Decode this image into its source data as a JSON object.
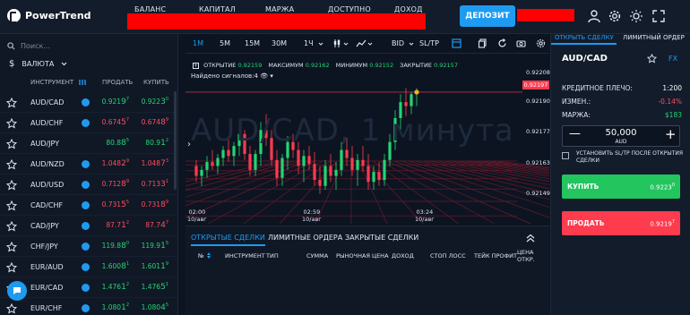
{
  "app": {
    "name": "PowerTrend"
  },
  "topbar": {
    "stats": [
      "БАЛАНС",
      "КАПИТАЛ",
      "МАРЖА",
      "ДОСТУПНО",
      "ДОХОД"
    ],
    "deposit_label": "ДЕПОЗИТ",
    "icons": [
      "user-icon",
      "gear-icon",
      "sun-icon",
      "fullscreen-icon"
    ]
  },
  "left": {
    "search_placeholder": "Поиск...",
    "currency_label": "ВАЛЮТА",
    "columns": {
      "instrument": "ИНСТРУМЕНТ",
      "sell": "ПРОДАТЬ",
      "buy": "КУПИТЬ"
    },
    "rows": [
      {
        "symbol": "AUD/CAD",
        "badge": true,
        "sell": [
          "0.921",
          "9",
          "7"
        ],
        "sell_dir": "green",
        "buy": [
          "0.922",
          "3",
          "0"
        ],
        "buy_dir": "green"
      },
      {
        "symbol": "AUD/CHF",
        "badge": true,
        "sell": [
          "0.674",
          "5",
          "7"
        ],
        "sell_dir": "red",
        "buy": [
          "0.674",
          "8",
          "9"
        ],
        "buy_dir": "red"
      },
      {
        "symbol": "AUD/JPY",
        "badge": false,
        "sell": [
          "80.8",
          "8",
          "5"
        ],
        "sell_dir": "green",
        "buy": [
          "80.9",
          "1",
          "2"
        ],
        "buy_dir": "green"
      },
      {
        "symbol": "AUD/NZD",
        "badge": true,
        "sell": [
          "1.048",
          "2",
          "9"
        ],
        "sell_dir": "red",
        "buy": [
          "1.048",
          "7",
          "3"
        ],
        "buy_dir": "red"
      },
      {
        "symbol": "AUD/USD",
        "badge": true,
        "sell": [
          "0.712",
          "8",
          "9"
        ],
        "sell_dir": "red",
        "buy": [
          "0.713",
          "3",
          "1"
        ],
        "buy_dir": "red"
      },
      {
        "symbol": "CAD/CHF",
        "badge": true,
        "sell": [
          "0.731",
          "5",
          "5"
        ],
        "sell_dir": "red",
        "buy": [
          "0.731",
          "8",
          "9"
        ],
        "buy_dir": "red"
      },
      {
        "symbol": "CAD/JPY",
        "badge": true,
        "sell": [
          "87.7",
          "1",
          "2"
        ],
        "sell_dir": "red",
        "buy": [
          "87.7",
          "4",
          "7"
        ],
        "buy_dir": "red"
      },
      {
        "symbol": "CHF/JPY",
        "badge": true,
        "sell": [
          "119.8",
          "8",
          "0"
        ],
        "sell_dir": "green",
        "buy": [
          "119.9",
          "1",
          "5"
        ],
        "buy_dir": "green"
      },
      {
        "symbol": "EUR/AUD",
        "badge": true,
        "sell": [
          "1.600",
          "8",
          "1"
        ],
        "sell_dir": "green",
        "buy": [
          "1.601",
          "1",
          "9"
        ],
        "buy_dir": "green"
      },
      {
        "symbol": "EUR/CAD",
        "badge": true,
        "sell": [
          "1.476",
          "1",
          "2"
        ],
        "sell_dir": "green",
        "buy": [
          "1.476",
          "5",
          "1"
        ],
        "buy_dir": "green"
      },
      {
        "symbol": "EUR/CHF",
        "badge": true,
        "sell": [
          "1.080",
          "1",
          "2"
        ],
        "sell_dir": "green",
        "buy": [
          "1.080",
          "4",
          "5"
        ],
        "buy_dir": "green"
      }
    ]
  },
  "toolbar": {
    "timeframes": [
      "1M",
      "5M",
      "15M",
      "30M",
      "1Ч"
    ],
    "active_timeframe": "1M",
    "bid_label": "BID",
    "sltp_label": "SL/TP"
  },
  "chart": {
    "ohlc": {
      "open_label": "ОТКРЫТИЕ",
      "open": "0.92159",
      "high_label": "МАКСИМУМ",
      "high": "0.92162",
      "low_label": "МИНИМУМ",
      "low": "0.92152",
      "close_label": "ЗАКРЫТИЕ",
      "close": "0.92157"
    },
    "signals": "Найдено сигналов:4",
    "watermark": "AUD/CAD, 1 минута",
    "current_price": "0.92197",
    "price_ticks": [
      "0.92208",
      "0.92190",
      "0.92177",
      "0.92163",
      "0.92149"
    ],
    "time_ticks": [
      {
        "time": "02:00",
        "date": "10/авг"
      },
      {
        "time": "02:59",
        "date": "10/авг"
      },
      {
        "time": "03:24",
        "date": "10/авг"
      }
    ]
  },
  "chart_data": {
    "type": "candlestick",
    "title": "AUD/CAD, 1 минута",
    "ylim": [
      0.9214,
      0.9221
    ],
    "candles": [
      [
        0.9216,
        0.92163,
        0.92152,
        0.92155
      ],
      [
        0.92155,
        0.9216,
        0.9215,
        0.92158
      ],
      [
        0.92158,
        0.92165,
        0.92154,
        0.92162
      ],
      [
        0.92162,
        0.92168,
        0.92158,
        0.9216
      ],
      [
        0.9216,
        0.92166,
        0.92156,
        0.92164
      ],
      [
        0.92164,
        0.9217,
        0.9216,
        0.92168
      ],
      [
        0.92168,
        0.92175,
        0.92162,
        0.92165
      ],
      [
        0.92165,
        0.92172,
        0.9216,
        0.9217
      ],
      [
        0.9217,
        0.9218,
        0.92165,
        0.92176
      ],
      [
        0.92176,
        0.92178,
        0.92163,
        0.92166
      ],
      [
        0.92166,
        0.9217,
        0.92155,
        0.92158
      ],
      [
        0.92158,
        0.92168,
        0.92155,
        0.92166
      ],
      [
        0.92166,
        0.92182,
        0.9216,
        0.92178
      ],
      [
        0.92178,
        0.92186,
        0.9217,
        0.92174
      ],
      [
        0.92174,
        0.92178,
        0.9216,
        0.92163
      ],
      [
        0.92163,
        0.92168,
        0.9215,
        0.92154
      ],
      [
        0.92154,
        0.92166,
        0.9215,
        0.92164
      ],
      [
        0.92164,
        0.92175,
        0.92158,
        0.92172
      ],
      [
        0.92172,
        0.92176,
        0.92164,
        0.92168
      ],
      [
        0.92168,
        0.92172,
        0.92156,
        0.9216
      ],
      [
        0.9216,
        0.92168,
        0.92152,
        0.92165
      ],
      [
        0.92165,
        0.9217,
        0.92158,
        0.92161
      ],
      [
        0.92161,
        0.92167,
        0.9215,
        0.92153
      ],
      [
        0.92153,
        0.9216,
        0.92146,
        0.9215
      ],
      [
        0.9215,
        0.92163,
        0.92148,
        0.9216
      ],
      [
        0.9216,
        0.92166,
        0.92152,
        0.92155
      ],
      [
        0.92155,
        0.92162,
        0.92148,
        0.92158
      ],
      [
        0.92158,
        0.92172,
        0.92155,
        0.92168
      ],
      [
        0.92168,
        0.92174,
        0.9216,
        0.92164
      ],
      [
        0.92164,
        0.9217,
        0.92155,
        0.92158
      ],
      [
        0.92158,
        0.92166,
        0.9215,
        0.92163
      ],
      [
        0.92163,
        0.9217,
        0.92157,
        0.9216
      ],
      [
        0.9216,
        0.92166,
        0.92148,
        0.92152
      ],
      [
        0.92152,
        0.9216,
        0.92148,
        0.92157
      ],
      [
        0.92157,
        0.92162,
        0.9215,
        0.92153
      ],
      [
        0.92153,
        0.92166,
        0.9215,
        0.92163
      ],
      [
        0.92163,
        0.92176,
        0.9216,
        0.92172
      ],
      [
        0.92172,
        0.92188,
        0.92168,
        0.92184
      ],
      [
        0.92184,
        0.92196,
        0.92178,
        0.92192
      ],
      [
        0.92192,
        0.92199,
        0.92185,
        0.9219
      ],
      [
        0.9219,
        0.92197,
        0.92186,
        0.92196
      ],
      [
        0.92196,
        0.92199,
        0.9219,
        0.92197
      ]
    ]
  },
  "trades": {
    "tabs": [
      "ОТКРЫТЫЕ СДЕЛКИ",
      "ЛИМИТНЫЕ ОРДЕРА",
      "ЗАКРЫТЫЕ СДЕЛКИ"
    ],
    "columns": [
      "№",
      "ИНСТРУМЕНТ",
      "ТИП",
      "СУММА",
      "РЫНОЧНАЯ ЦЕНА",
      "ДОХОД",
      "СТОП ЛОСС",
      "ТЕЙК ПРОФИТ",
      "ЦЕНА",
      "ОТКР."
    ]
  },
  "order": {
    "tabs": [
      "ОТКРЫТЬ СДЕЛКУ",
      "ЛИМИТНЫЙ ОРДЕР"
    ],
    "pair": "AUD/CAD",
    "fx_label": "FX",
    "leverage_label": "КРЕДИТНОЕ ПЛЕЧО:",
    "leverage": "1:200",
    "change_label": "ИЗМЕН.:",
    "change": "-0.14%",
    "margin_label": "МАРЖА:",
    "margin": "$183",
    "amount": "50,000",
    "amount_currency": "AUD",
    "sltp_checkbox": "УСТАНОВИТЬ SL/TP ПОСЛЕ ОТКРЫТИЯ СДЕЛКИ",
    "buy_label": "КУПИТЬ",
    "buy_price": [
      "0.9223",
      "0"
    ],
    "sell_label": "ПРОДАТЬ",
    "sell_price": [
      "0.9219",
      "7"
    ]
  }
}
